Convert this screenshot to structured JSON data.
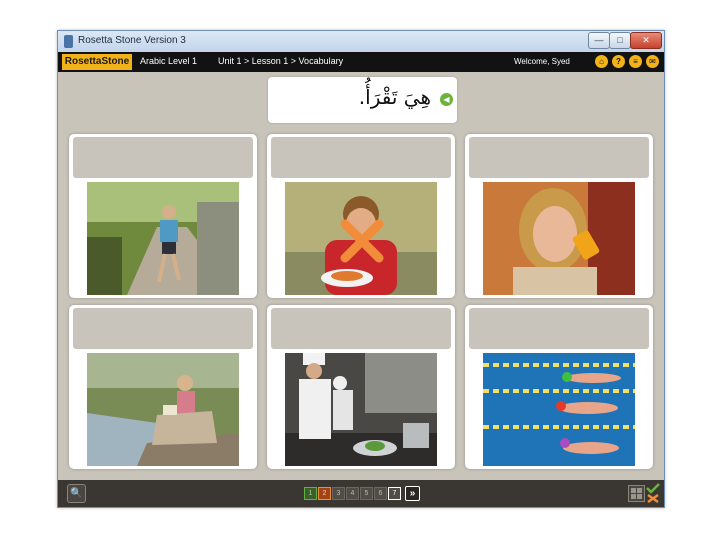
{
  "window": {
    "title": "Rosetta Stone Version 3"
  },
  "appbar": {
    "logo": "RosettaStone",
    "course": "Arabic Level 1",
    "breadcrumb": "Unit 1 > Lesson 1 > Vocabulary",
    "welcome": "Welcome, Syed",
    "icons": [
      "home-icon",
      "help-icon",
      "menu-icon",
      "chat-icon"
    ]
  },
  "prompt": {
    "arabic_text": "هِيَ تَقْرَأُ."
  },
  "cards": [
    {
      "id": "runner",
      "selected_wrong": false
    },
    {
      "id": "boy-eating",
      "selected_wrong": true
    },
    {
      "id": "woman-drinking",
      "selected_wrong": false
    },
    {
      "id": "woman-reading",
      "selected_wrong": false
    },
    {
      "id": "chefs-cooking",
      "selected_wrong": false
    },
    {
      "id": "swimmers",
      "selected_wrong": false
    }
  ],
  "pager": {
    "pages": [
      "1",
      "2",
      "3",
      "4",
      "5",
      "6",
      "7"
    ],
    "next_symbol": "»"
  },
  "colors": {
    "accent": "#f2b21a",
    "correct": "#6bb33a",
    "wrong": "#f08c3a"
  }
}
